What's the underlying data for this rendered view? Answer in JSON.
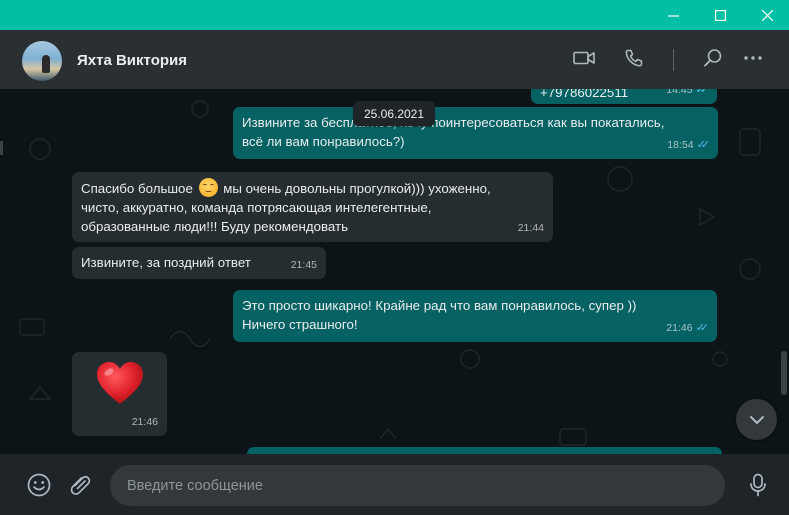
{
  "window": {
    "controls": {
      "minimize_icon": "minimize-icon",
      "maximize_icon": "maximize-icon",
      "close_icon": "close-icon"
    },
    "accent_color": "#00bfa5"
  },
  "header": {
    "contact_name": "Яхта Виктория",
    "icons": [
      "video-call-icon",
      "voice-call-icon",
      "search-icon",
      "menu-icon"
    ]
  },
  "chat": {
    "date_separator": "25.06.2021",
    "messages": [
      {
        "id": "m0",
        "direction": "out",
        "text": "+79786022511",
        "time": "14:45",
        "status": "read"
      },
      {
        "id": "m1",
        "direction": "out",
        "text_line1": "Извините за бесплатное, хочу поинтересоваться как вы покатались,",
        "text_line2": "всё ли вам понравилось?)",
        "time": "18:54",
        "status": "read"
      },
      {
        "id": "m2",
        "direction": "in",
        "text_before_emoji": "Спасибо большое",
        "emoji": "smiling-face-emoji",
        "text_after_emoji": "мы очень довольны прогулкой))) ухоженно,",
        "text_line2": "чисто, аккуратно, команда потрясающая интелегентные,",
        "text_line3": "образованные люди!!! Буду рекомендовать",
        "time": "21:44"
      },
      {
        "id": "m3",
        "direction": "in",
        "text": "Извините, за поздний ответ",
        "time": "21:45"
      },
      {
        "id": "m4",
        "direction": "out",
        "text_line1": "Это просто шикарно! Крайне рад что вам понравилось, супер ))",
        "text_line2": "Ничего страшного!",
        "time": "21:46",
        "status": "read"
      },
      {
        "id": "m5",
        "direction": "in",
        "emoji": "red-heart-emoji",
        "time": "21:46"
      }
    ],
    "incoming_bubble_color": "#262d31",
    "outgoing_bubble_color": "#056162",
    "read_tick_color": "#53bdeb"
  },
  "composer": {
    "placeholder": "Введите сообщение",
    "value": "",
    "icons": [
      "emoji-icon",
      "attach-icon",
      "microphone-icon"
    ]
  }
}
